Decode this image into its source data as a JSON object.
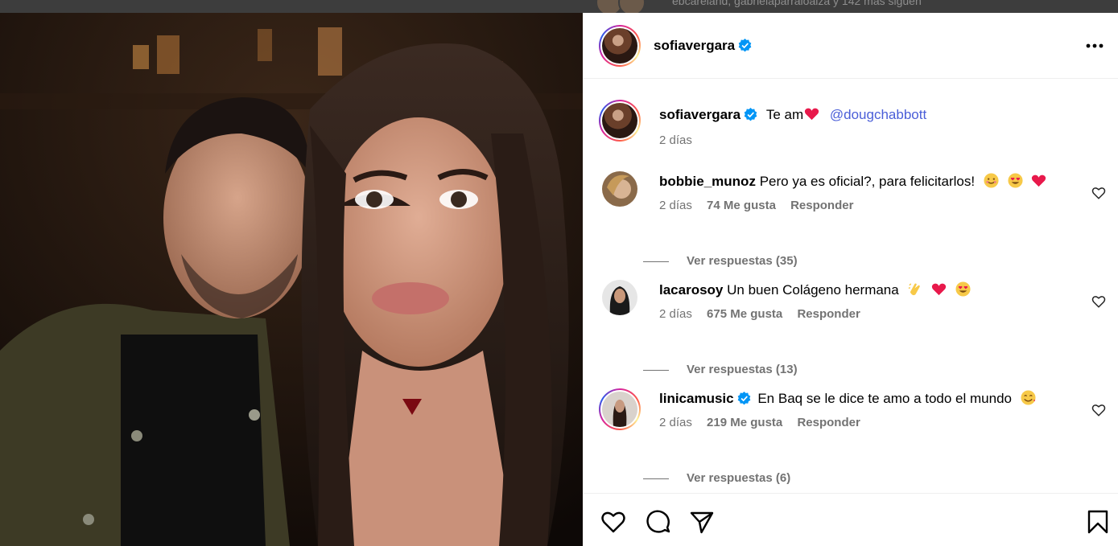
{
  "backdrop": {
    "followers_text": "ebcareland, gabrielaparraloaiza y 142 más siguen"
  },
  "post": {
    "username": "sofiavergara",
    "verified": true,
    "more_icon": "more-horizontal-icon",
    "caption": {
      "username": "sofiavergara",
      "text": "Te am",
      "emoji": "red-heart",
      "mention": "@dougchabbott",
      "time": "2 días"
    }
  },
  "comments": [
    {
      "username": "bobbie_munoz",
      "verified": false,
      "text": "Pero ya es oficial?, para felicitarlos!",
      "emojis": [
        "smiling-face",
        "heart-eyes",
        "red-heart"
      ],
      "time": "2 días",
      "likes": "74 Me gusta",
      "reply_label": "Responder",
      "view_replies": "Ver respuestas (35)"
    },
    {
      "username": "lacarosoy",
      "verified": false,
      "text": "Un buen Colágeno hermana",
      "emojis": [
        "clapping-hands",
        "red-heart",
        "heart-eyes"
      ],
      "time": "2 días",
      "likes": "675 Me gusta",
      "reply_label": "Responder",
      "view_replies": "Ver respuestas (13)"
    },
    {
      "username": "linicamusic",
      "verified": true,
      "text": "En Baq se le dice te amo a todo el mundo",
      "emojis": [
        "smiling-face-with-hearts"
      ],
      "time": "2 días",
      "likes": "219 Me gusta",
      "reply_label": "Responder",
      "view_replies": "Ver respuestas (6)"
    }
  ],
  "colors": {
    "verified": "#0095f6",
    "mention": "#4a5ed8",
    "muted": "#737373",
    "heart": "#e8194b"
  }
}
